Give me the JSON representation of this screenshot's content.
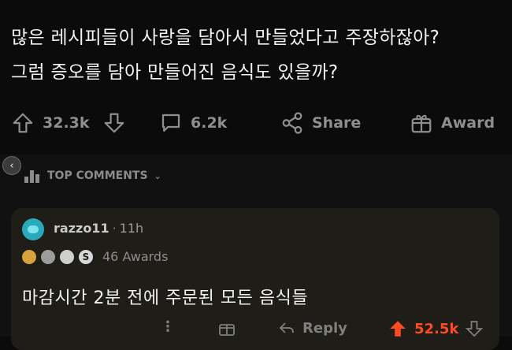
{
  "post": {
    "title_line1": "많은 레시피들이 사랑을 담아서 만들었다고 주장하잖아?",
    "title_line2": "그럼 증오를 담아 만들어진 음식도 있을까?"
  },
  "actions": {
    "upvotes": "32.3k",
    "comments": "6.2k",
    "share": "Share",
    "award": "Award"
  },
  "top_comments": {
    "label": "TOP COMMENTS",
    "chevron": "⌄"
  },
  "comment": {
    "username": "razzo11",
    "separator": "·",
    "time": "11h",
    "awards_count": "46 Awards",
    "award_coin_letter": "S",
    "body": "마감시간 2분 전에 주문된 모든 음식들",
    "reply": "Reply",
    "score": "52.5k",
    "more": "⋮"
  },
  "nav": {
    "arrow": "‹"
  },
  "colors": {
    "upvote_active": "#ff4b1f",
    "muted": "#8e8e8e",
    "card_bg": "#1f1d17"
  },
  "icons": [
    "upvote-arrow-icon",
    "downvote-arrow-icon",
    "comment-bubble-icon",
    "share-icon",
    "award-gift-icon",
    "chart-bars-icon",
    "more-dots-icon",
    "reply-arrow-icon"
  ]
}
